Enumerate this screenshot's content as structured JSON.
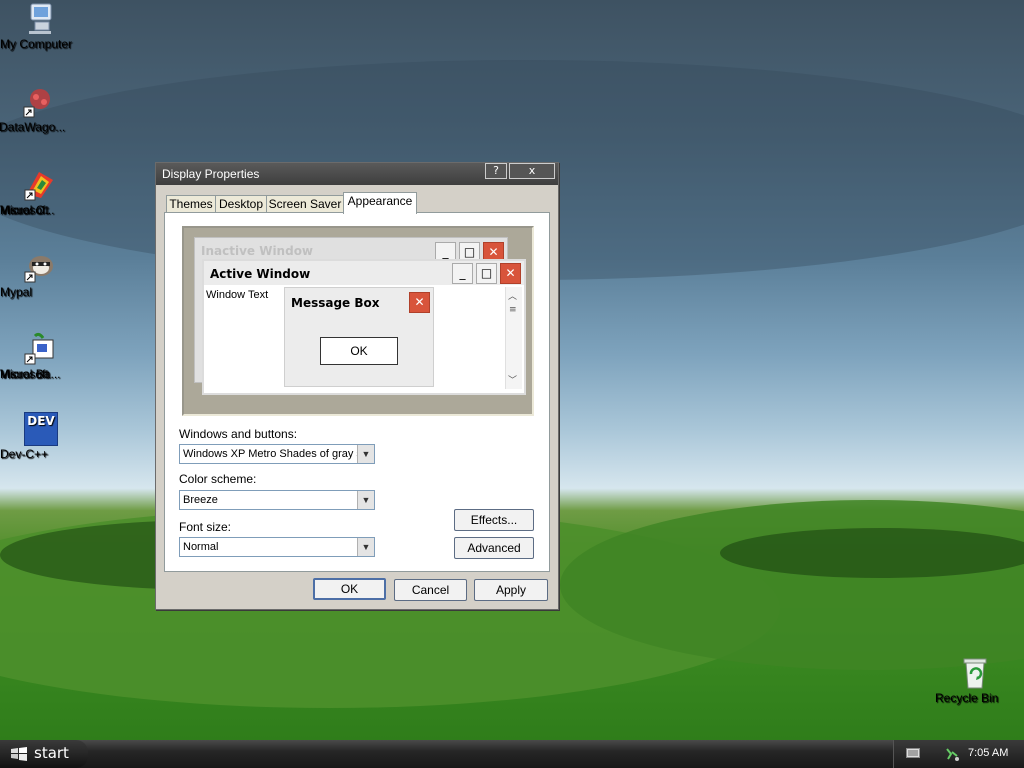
{
  "desktop": {
    "icons": [
      {
        "label": "My Computer"
      },
      {
        "label": "DataWago..."
      },
      {
        "label_line1": "Microsoft",
        "label_line2": "Visual C..."
      },
      {
        "label": "Mypal"
      },
      {
        "label_line1": "Microsoft",
        "label_line2": "Visual Ba..."
      },
      {
        "label": "Dev-C++",
        "badge": "DEV"
      },
      {
        "label": "Recycle Bin"
      }
    ]
  },
  "window": {
    "title": "Display Properties",
    "help_glyph": "?",
    "close_glyph": "x",
    "tabs": [
      {
        "label": "Themes"
      },
      {
        "label": "Desktop"
      },
      {
        "label": "Screen Saver"
      },
      {
        "label": "Appearance",
        "active": true
      }
    ],
    "preview": {
      "inactive_title": "Inactive Window",
      "active_title": "Active Window",
      "window_text": "Window Text",
      "message_box_title": "Message Box",
      "ok_label": "OK"
    },
    "fields": {
      "windows_buttons_label": "Windows and buttons:",
      "windows_buttons_value": "Windows XP Metro Shades of gray s",
      "color_scheme_label": "Color scheme:",
      "color_scheme_value": "Breeze",
      "font_size_label": "Font size:",
      "font_size_value": "Normal"
    },
    "buttons": {
      "effects": "Effects...",
      "advanced": "Advanced",
      "ok": "OK",
      "cancel": "Cancel",
      "apply": "Apply"
    }
  },
  "taskbar": {
    "start_label": "start",
    "clock": "7:05 AM"
  }
}
